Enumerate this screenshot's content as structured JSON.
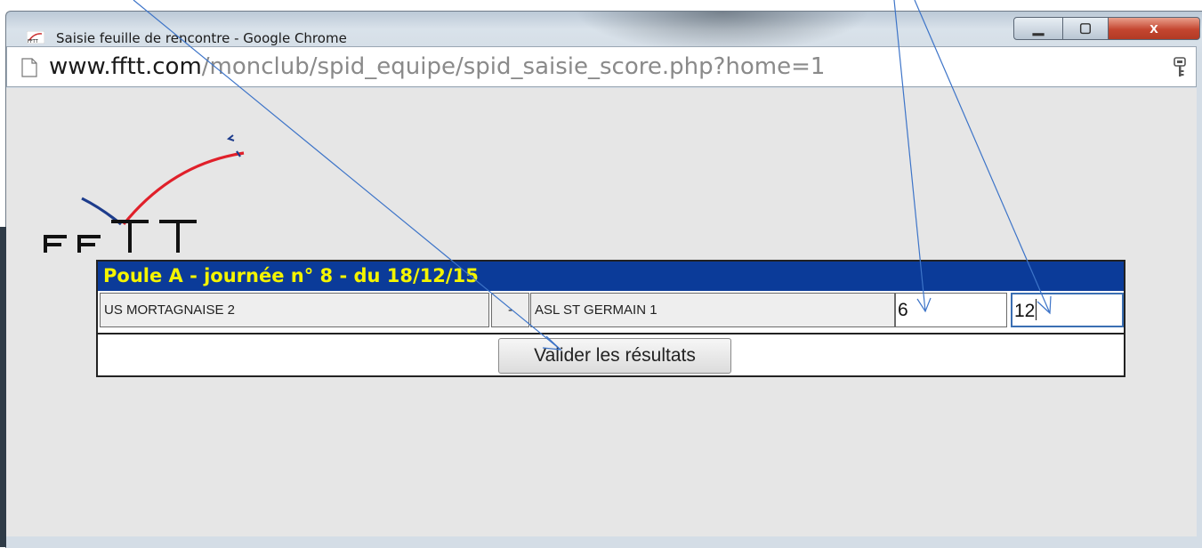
{
  "window": {
    "title": "Saisie feuille de rencontre - Google Chrome",
    "controls": {
      "minimize": "▁",
      "maximize": "▢",
      "close": "x"
    }
  },
  "address_bar": {
    "host": "www.fftt.com",
    "path": "/monclub/spid_equipe/spid_saisie_score.php?home=1"
  },
  "logo": {
    "text": "FFTT"
  },
  "match": {
    "header": "Poule A - journée n° 8 - du 18/12/15",
    "home_team": "US MORTAGNAISE 2",
    "separator": "-",
    "away_team": "ASL ST GERMAIN 1",
    "home_score": "6",
    "away_score": "12",
    "submit_label": "Valider les résultats"
  },
  "colors": {
    "header_bg": "#0b3b99",
    "header_text": "#f4f400",
    "annotation_arrow": "#3d74c8"
  },
  "icons": [
    "chrome-app-icon",
    "page-icon",
    "key-icon",
    "minimize-icon",
    "maximize-icon",
    "close-icon"
  ]
}
